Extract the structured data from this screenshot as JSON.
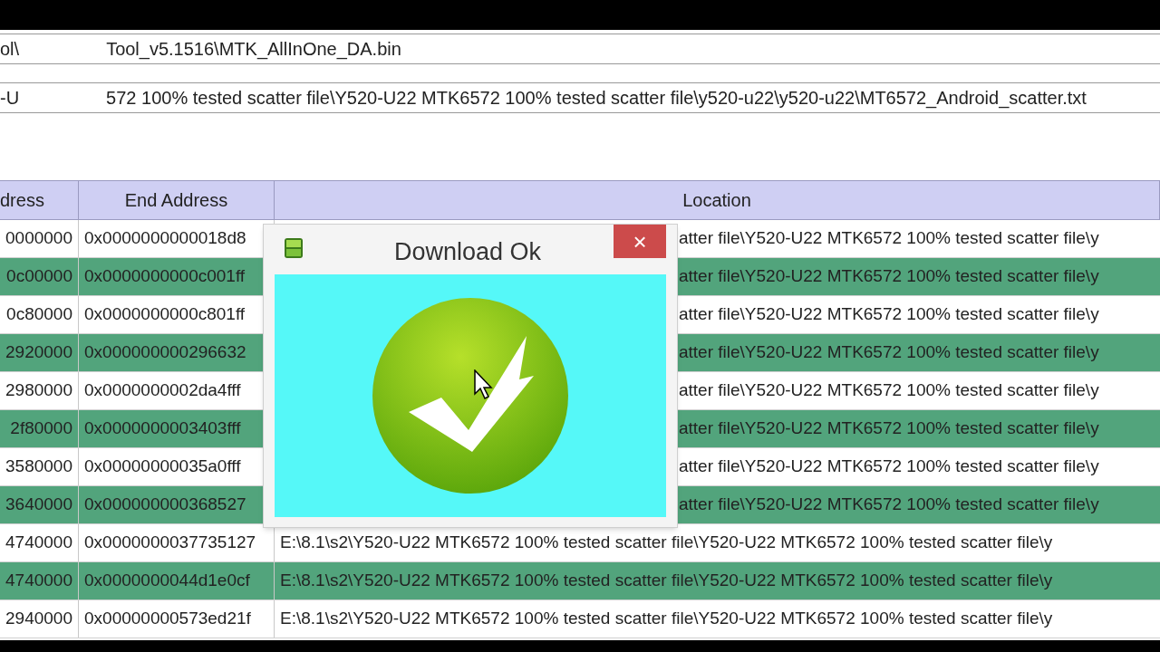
{
  "path_fields": [
    {
      "segments": [
        "ol\\",
        "Tool_v5.1516\\MTK_AllInOne_DA.bin"
      ]
    },
    {
      "segments": [
        "-U",
        "572 100% tested scatter file\\Y520-U22 MTK6572 100% tested scatter file\\y520-u22\\y520-u22\\MT6572_Android_scatter.txt"
      ]
    }
  ],
  "table": {
    "columns": [
      "dress",
      "End Address",
      "Location"
    ],
    "rows": [
      {
        "start": "0000000",
        "end": "0x0000000000018d8",
        "location": "atter file\\Y520-U22 MTK6572 100% tested scatter file\\y",
        "covered": true,
        "shaded": false
      },
      {
        "start": "0c00000",
        "end": "0x0000000000c001ff",
        "location": "atter file\\Y520-U22 MTK6572 100% tested scatter file\\y",
        "covered": true,
        "shaded": true
      },
      {
        "start": "0c80000",
        "end": "0x0000000000c801ff",
        "location": "atter file\\Y520-U22 MTK6572 100% tested scatter file\\y",
        "covered": true,
        "shaded": false
      },
      {
        "start": "2920000",
        "end": "0x000000000296632",
        "location": "atter file\\Y520-U22 MTK6572 100% tested scatter file\\y",
        "covered": true,
        "shaded": true
      },
      {
        "start": "2980000",
        "end": "0x0000000002da4fff",
        "location": "atter file\\Y520-U22 MTK6572 100% tested scatter file\\y",
        "covered": true,
        "shaded": false
      },
      {
        "start": "2f80000",
        "end": "0x0000000003403fff",
        "location": "atter file\\Y520-U22 MTK6572 100% tested scatter file\\y",
        "covered": true,
        "shaded": true
      },
      {
        "start": "3580000",
        "end": "0x00000000035a0fff",
        "location": "atter file\\Y520-U22 MTK6572 100% tested scatter file\\y",
        "covered": true,
        "shaded": false
      },
      {
        "start": "3640000",
        "end": "0x000000000368527",
        "location": "atter file\\Y520-U22 MTK6572 100% tested scatter file\\y",
        "covered": true,
        "shaded": true
      },
      {
        "start": "4740000",
        "end": "0x0000000037735127",
        "location": "E:\\8.1\\s2\\Y520-U22 MTK6572 100% tested scatter file\\Y520-U22 MTK6572 100% tested scatter file\\y",
        "covered": false,
        "shaded": false
      },
      {
        "start": "4740000",
        "end": "0x0000000044d1e0cf",
        "location": "E:\\8.1\\s2\\Y520-U22 MTK6572 100% tested scatter file\\Y520-U22 MTK6572 100% tested scatter file\\y",
        "covered": false,
        "shaded": true
      },
      {
        "start": "2940000",
        "end": "0x00000000573ed21f",
        "location": "E:\\8.1\\s2\\Y520-U22 MTK6572 100% tested scatter file\\Y520-U22 MTK6572 100% tested scatter file\\y",
        "covered": false,
        "shaded": false
      }
    ]
  },
  "dialog": {
    "title": "Download Ok",
    "close": "×"
  }
}
